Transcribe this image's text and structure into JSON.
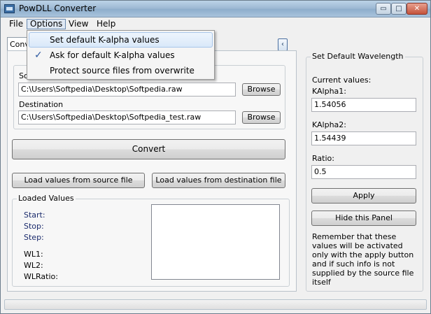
{
  "window": {
    "title": "PowDLL Converter",
    "minimize": "▭",
    "maximize": "□",
    "close": "✕"
  },
  "menu": {
    "items": [
      "File",
      "Options",
      "View",
      "Help"
    ]
  },
  "options_menu": {
    "items": [
      {
        "label": "Set default K-alpha values",
        "checked": false
      },
      {
        "label": "Ask for default K-alpha values",
        "checked": true
      },
      {
        "label": "Protect source files from overwrite",
        "checked": false
      }
    ],
    "check_glyph": "✓"
  },
  "tab": {
    "label": "Conv"
  },
  "collapse_button": "‹",
  "source": {
    "label": "So",
    "value": "C:\\Users\\Softpedia\\Desktop\\Softpedia.raw",
    "browse": "Browse"
  },
  "destination": {
    "label": "Destination",
    "value": "C:\\Users\\Softpedia\\Desktop\\Softpedia_test.raw",
    "browse": "Browse"
  },
  "convert_button": "Convert",
  "load_source_button": "Load values from source file",
  "load_destination_button": "Load values from destination  file",
  "loaded_values": {
    "title": "Loaded Values",
    "start": "Start:",
    "stop": "Stop:",
    "step": "Step:",
    "wl1": "WL1:",
    "wl2": "WL2:",
    "wlratio": "WLRatio:"
  },
  "wavelength_panel": {
    "title": "Set Default Wavelength",
    "current_values": "Current values:",
    "kalpha1_label": "KAlpha1:",
    "kalpha1_value": "1.54056",
    "kalpha2_label": "KAlpha2:",
    "kalpha2_value": "1.54439",
    "ratio_label": "Ratio:",
    "ratio_value": "0.5",
    "apply_button": "Apply",
    "hide_button": "Hide this Panel",
    "note": "Remember that these values will be activated only with the apply button and if such info is not supplied by the source file itself"
  }
}
